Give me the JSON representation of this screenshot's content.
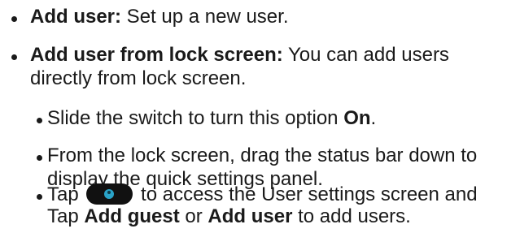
{
  "items": [
    {
      "bold": "Add user:",
      "text": " Set up a new user."
    },
    {
      "bold": "Add user from lock screen:",
      "text_line1": " You can add users",
      "text_line2": "directly from lock screen."
    }
  ],
  "subitems": [
    {
      "pre": "Slide the switch to turn this option ",
      "bold": "On",
      "post": "."
    },
    {
      "line1": "From the lock screen, drag the status bar down to",
      "line2": "display the quick settings panel."
    },
    {
      "tap": "Tap",
      "icon": "user-switch-icon",
      "after_icon": "to access the User settings screen and",
      "line2_pre": "Tap ",
      "bold1": "Add guest",
      "mid": " or ",
      "bold2": "Add user",
      "post": " to add users."
    }
  ],
  "colors": {
    "text": "#1a1a1a",
    "icon_background": "#111111",
    "icon_accent": "#2aa3c8"
  }
}
